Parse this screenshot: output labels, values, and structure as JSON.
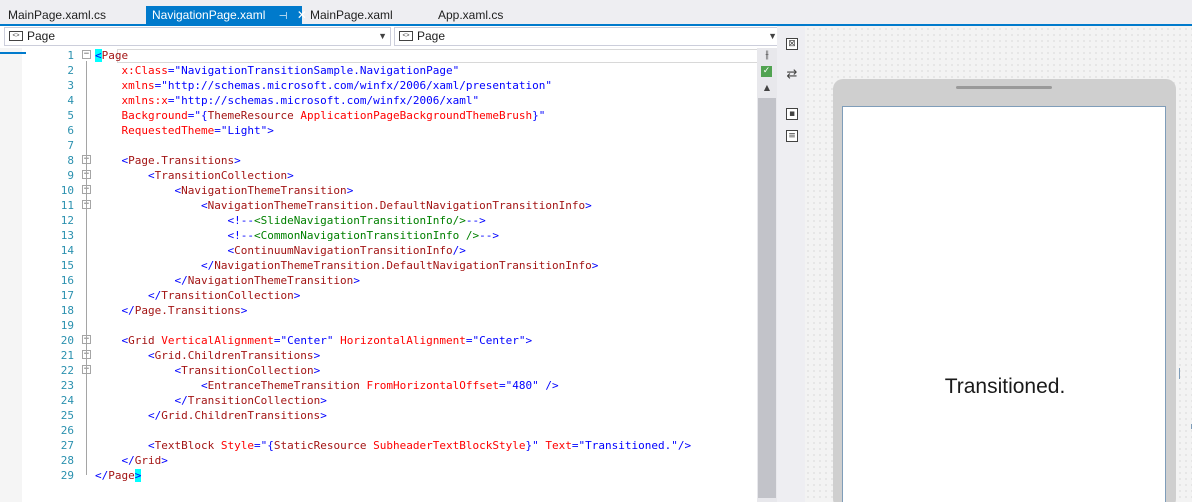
{
  "tabs": [
    {
      "label": "MainPage.xaml.cs",
      "active": false
    },
    {
      "label": "NavigationPage.xaml",
      "active": true,
      "pin": "⊣",
      "close": "✕"
    },
    {
      "label": "MainPage.xaml",
      "active": false
    },
    {
      "label": "App.xaml.cs",
      "active": false
    }
  ],
  "nav": {
    "left_label": "Page",
    "right_label": "Page"
  },
  "code_lines": [
    {
      "n": "1",
      "fold": "-",
      "tokens": [
        [
          "br",
          "<"
        ],
        [
          "el",
          "Page"
        ]
      ]
    },
    {
      "n": "2",
      "tokens": [
        [
          "tx",
          "    "
        ],
        [
          "at",
          "x:Class"
        ],
        [
          "br",
          "="
        ],
        [
          "val",
          "\"NavigationTransitionSample.NavigationPage\""
        ]
      ]
    },
    {
      "n": "3",
      "tokens": [
        [
          "tx",
          "    "
        ],
        [
          "at",
          "xmlns"
        ],
        [
          "br",
          "="
        ],
        [
          "val",
          "\"http://schemas.microsoft.com/winfx/2006/xaml/presentation\""
        ]
      ]
    },
    {
      "n": "4",
      "tokens": [
        [
          "tx",
          "    "
        ],
        [
          "at",
          "xmlns:x"
        ],
        [
          "br",
          "="
        ],
        [
          "val",
          "\"http://schemas.microsoft.com/winfx/2006/xaml\""
        ]
      ]
    },
    {
      "n": "5",
      "tokens": [
        [
          "tx",
          "    "
        ],
        [
          "at",
          "Background"
        ],
        [
          "br",
          "="
        ],
        [
          "val",
          "\"{"
        ],
        [
          "el",
          "ThemeResource"
        ],
        [
          "at",
          " ApplicationPageBackgroundThemeBrush"
        ],
        [
          "val",
          "}\""
        ]
      ]
    },
    {
      "n": "6",
      "tokens": [
        [
          "tx",
          "    "
        ],
        [
          "at",
          "RequestedTheme"
        ],
        [
          "br",
          "="
        ],
        [
          "val",
          "\"Light\""
        ],
        [
          "br",
          ">"
        ]
      ]
    },
    {
      "n": "7",
      "tokens": []
    },
    {
      "n": "8",
      "fold": "-",
      "tokens": [
        [
          "tx",
          "    "
        ],
        [
          "br",
          "<"
        ],
        [
          "el",
          "Page.Transitions"
        ],
        [
          "br",
          ">"
        ]
      ]
    },
    {
      "n": "9",
      "fold": "-",
      "tokens": [
        [
          "tx",
          "        "
        ],
        [
          "br",
          "<"
        ],
        [
          "el",
          "TransitionCollection"
        ],
        [
          "br",
          ">"
        ]
      ]
    },
    {
      "n": "10",
      "fold": "-",
      "tokens": [
        [
          "tx",
          "            "
        ],
        [
          "br",
          "<"
        ],
        [
          "el",
          "NavigationThemeTransition"
        ],
        [
          "br",
          ">"
        ]
      ]
    },
    {
      "n": "11",
      "fold": "-",
      "tokens": [
        [
          "tx",
          "                "
        ],
        [
          "br",
          "<"
        ],
        [
          "el",
          "NavigationThemeTransition.DefaultNavigationTransitionInfo"
        ],
        [
          "br",
          ">"
        ]
      ]
    },
    {
      "n": "12",
      "tokens": [
        [
          "tx",
          "                    "
        ],
        [
          "br",
          "<!--"
        ],
        [
          "cm",
          "<SlideNavigationTransitionInfo/>"
        ],
        [
          "br",
          "-->"
        ]
      ]
    },
    {
      "n": "13",
      "tokens": [
        [
          "tx",
          "                    "
        ],
        [
          "br",
          "<!--"
        ],
        [
          "cm",
          "<CommonNavigationTransitionInfo />"
        ],
        [
          "br",
          "-->"
        ]
      ]
    },
    {
      "n": "14",
      "tokens": [
        [
          "tx",
          "                    "
        ],
        [
          "br",
          "<"
        ],
        [
          "el",
          "ContinuumNavigationTransitionInfo"
        ],
        [
          "br",
          "/>"
        ]
      ]
    },
    {
      "n": "15",
      "tokens": [
        [
          "tx",
          "                "
        ],
        [
          "br",
          "</"
        ],
        [
          "el",
          "NavigationThemeTransition.DefaultNavigationTransitionInfo"
        ],
        [
          "br",
          ">"
        ]
      ]
    },
    {
      "n": "16",
      "tokens": [
        [
          "tx",
          "            "
        ],
        [
          "br",
          "</"
        ],
        [
          "el",
          "NavigationThemeTransition"
        ],
        [
          "br",
          ">"
        ]
      ]
    },
    {
      "n": "17",
      "tokens": [
        [
          "tx",
          "        "
        ],
        [
          "br",
          "</"
        ],
        [
          "el",
          "TransitionCollection"
        ],
        [
          "br",
          ">"
        ]
      ]
    },
    {
      "n": "18",
      "tokens": [
        [
          "tx",
          "    "
        ],
        [
          "br",
          "</"
        ],
        [
          "el",
          "Page.Transitions"
        ],
        [
          "br",
          ">"
        ]
      ]
    },
    {
      "n": "19",
      "tokens": []
    },
    {
      "n": "20",
      "fold": "-",
      "tokens": [
        [
          "tx",
          "    "
        ],
        [
          "br",
          "<"
        ],
        [
          "el",
          "Grid"
        ],
        [
          "at",
          " VerticalAlignment"
        ],
        [
          "br",
          "="
        ],
        [
          "val",
          "\"Center\""
        ],
        [
          "at",
          " HorizontalAlignment"
        ],
        [
          "br",
          "="
        ],
        [
          "val",
          "\"Center\""
        ],
        [
          "br",
          ">"
        ]
      ]
    },
    {
      "n": "21",
      "fold": "-",
      "tokens": [
        [
          "tx",
          "        "
        ],
        [
          "br",
          "<"
        ],
        [
          "el",
          "Grid.ChildrenTransitions"
        ],
        [
          "br",
          ">"
        ]
      ]
    },
    {
      "n": "22",
      "fold": "-",
      "tokens": [
        [
          "tx",
          "            "
        ],
        [
          "br",
          "<"
        ],
        [
          "el",
          "TransitionCollection"
        ],
        [
          "br",
          ">"
        ]
      ]
    },
    {
      "n": "23",
      "tokens": [
        [
          "tx",
          "                "
        ],
        [
          "br",
          "<"
        ],
        [
          "el",
          "EntranceThemeTransition"
        ],
        [
          "at",
          " FromHorizontalOffset"
        ],
        [
          "br",
          "="
        ],
        [
          "val",
          "\"480\""
        ],
        [
          "br",
          " />"
        ]
      ]
    },
    {
      "n": "24",
      "tokens": [
        [
          "tx",
          "            "
        ],
        [
          "br",
          "</"
        ],
        [
          "el",
          "TransitionCollection"
        ],
        [
          "br",
          ">"
        ]
      ]
    },
    {
      "n": "25",
      "tokens": [
        [
          "tx",
          "        "
        ],
        [
          "br",
          "</"
        ],
        [
          "el",
          "Grid.ChildrenTransitions"
        ],
        [
          "br",
          ">"
        ]
      ]
    },
    {
      "n": "26",
      "tokens": []
    },
    {
      "n": "27",
      "tokens": [
        [
          "tx",
          "        "
        ],
        [
          "br",
          "<"
        ],
        [
          "el",
          "TextBlock"
        ],
        [
          "at",
          " Style"
        ],
        [
          "br",
          "="
        ],
        [
          "val",
          "\"{"
        ],
        [
          "el",
          "StaticResource"
        ],
        [
          "at",
          " SubheaderTextBlockStyle"
        ],
        [
          "val",
          "}\""
        ],
        [
          "at",
          " Text"
        ],
        [
          "br",
          "="
        ],
        [
          "val",
          "\"Transitioned.\""
        ],
        [
          "br",
          "/>"
        ]
      ]
    },
    {
      "n": "28",
      "tokens": [
        [
          "tx",
          "    "
        ],
        [
          "br",
          "</"
        ],
        [
          "el",
          "Grid"
        ],
        [
          "br",
          ">"
        ]
      ]
    },
    {
      "n": "29",
      "tokens": [
        [
          "br",
          "</"
        ],
        [
          "el",
          "Page"
        ],
        [
          "br",
          ">"
        ]
      ]
    }
  ],
  "designer": {
    "screen_text": "Transitioned."
  },
  "icons": {
    "nav_dropdown": "xaml-element-icon",
    "split": "split-view-icon",
    "check": "check-icon",
    "swap": "swap-panes-icon"
  },
  "colors": {
    "accent": "#007acc",
    "element": "#a31515",
    "attribute": "#ff0000",
    "value": "#0000ff",
    "comment": "#008000",
    "line_number": "#2b91af"
  }
}
